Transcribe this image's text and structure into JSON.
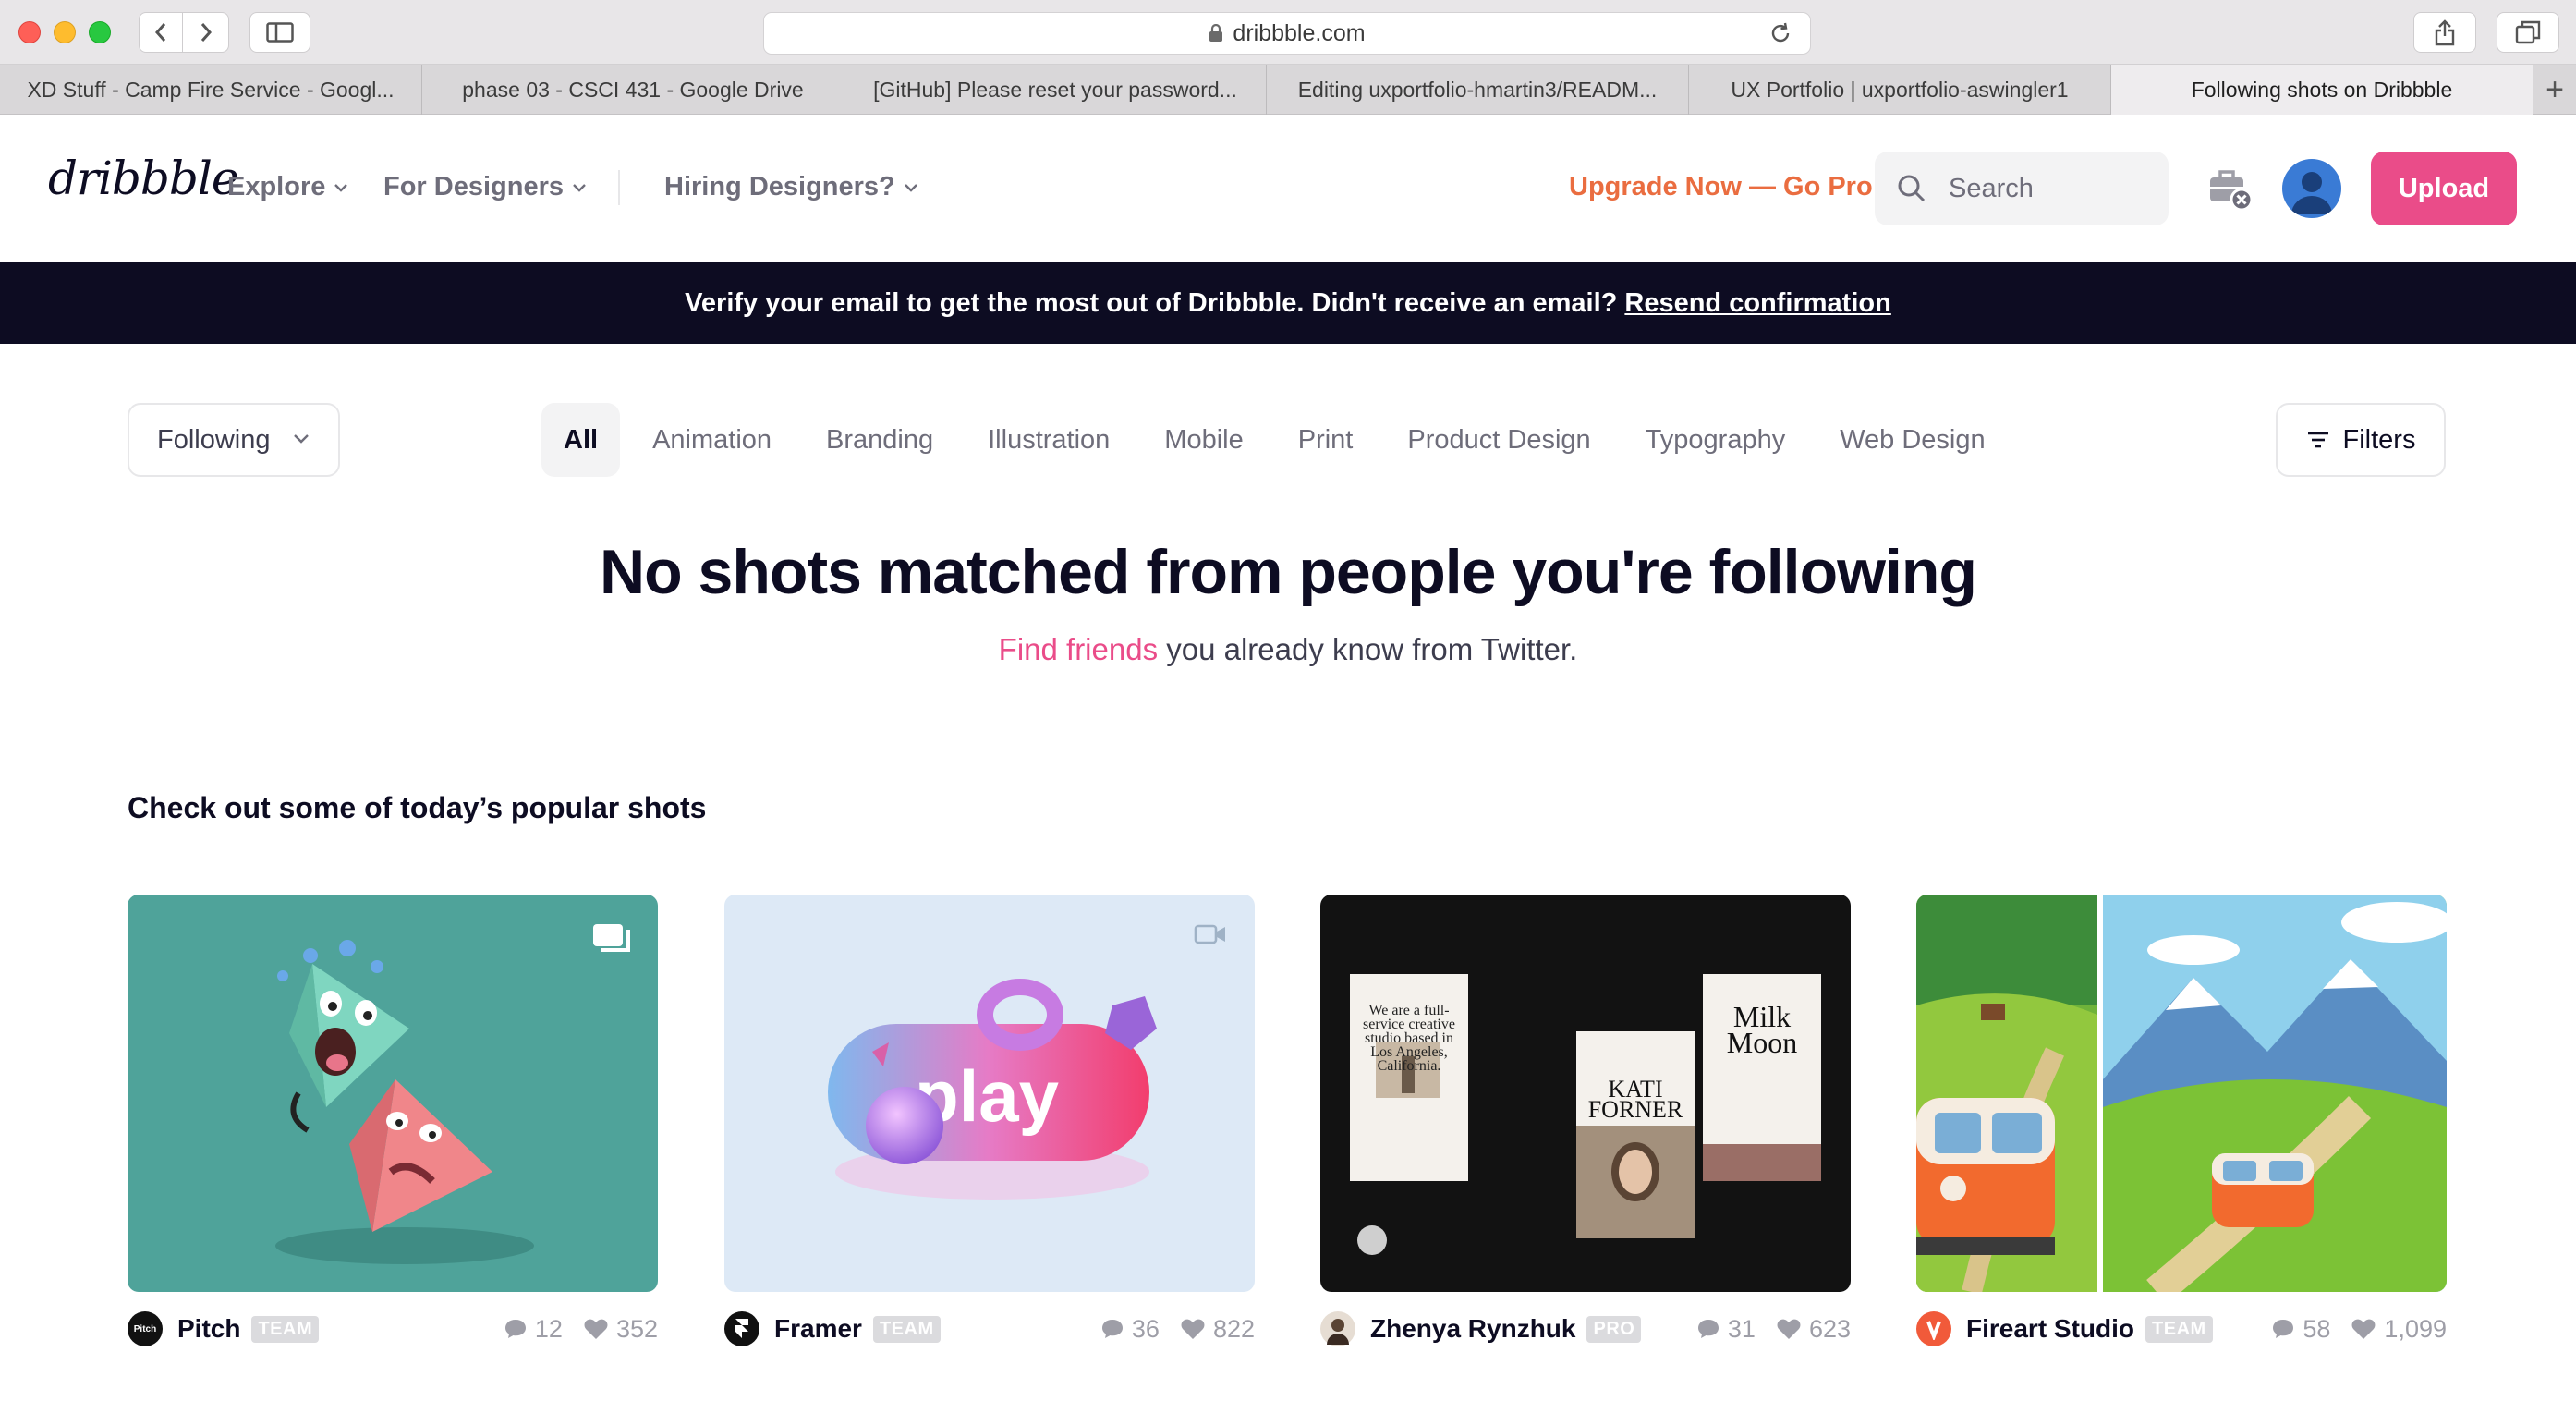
{
  "browser": {
    "url": "dribbble.com",
    "tabs": [
      {
        "label": "XD Stuff - Camp Fire Service - Googl...",
        "active": false
      },
      {
        "label": "phase 03 - CSCI 431 - Google Drive",
        "active": false
      },
      {
        "label": "[GitHub] Please reset your password...",
        "active": false
      },
      {
        "label": "Editing uxportfolio-hmartin3/READM...",
        "active": false
      },
      {
        "label": "UX Portfolio | uxportfolio-aswingler1",
        "active": false
      },
      {
        "label": "Following shots on Dribbble",
        "active": true
      }
    ],
    "new_tab_label": "+"
  },
  "header": {
    "logo": "dribbble",
    "nav": {
      "explore": "Explore",
      "for_designers": "For Designers",
      "hiring": "Hiring Designers?"
    },
    "upgrade": "Upgrade Now — Go Pro",
    "search_placeholder": "Search",
    "upload": "Upload"
  },
  "banner": {
    "text": "Verify your email to get the most out of Dribbble. Didn't receive an email?",
    "link": "Resend confirmation"
  },
  "filters": {
    "following": "Following",
    "categories": [
      "All",
      "Animation",
      "Branding",
      "Illustration",
      "Mobile",
      "Print",
      "Product Design",
      "Typography",
      "Web Design"
    ],
    "active_category": "All",
    "filters_label": "Filters"
  },
  "empty_state": {
    "title": "No shots matched from people you're following",
    "find_link": "Find friends",
    "subtitle_rest": " you already know from Twitter."
  },
  "popular": {
    "heading": "Check out some of today’s popular shots",
    "shots": [
      {
        "name": "Pitch",
        "badge": "TEAM",
        "comments": "12",
        "likes": "352",
        "avatar_text": "Pitch"
      },
      {
        "name": "Framer",
        "badge": "TEAM",
        "comments": "36",
        "likes": "822",
        "thumb_text": "play"
      },
      {
        "name": "Zhenya Rynzhuk",
        "badge": "PRO",
        "comments": "31",
        "likes": "623",
        "thumb_texts": {
          "card_a": "We are a full-service creative studio based in Los Angeles, California.",
          "card_b": "KATI FORNER",
          "card_c": "Milk Moon"
        }
      },
      {
        "name": "Fireart Studio",
        "badge": "TEAM",
        "comments": "58",
        "likes": "1,099"
      }
    ]
  },
  "colors": {
    "brand_pink": "#ea4c89",
    "upgrade_orange": "#ea6d40",
    "banner_bg": "#0d0c22"
  }
}
